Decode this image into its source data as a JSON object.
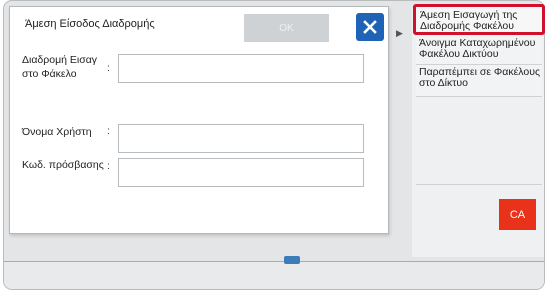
{
  "dialog": {
    "title": "Άμεση Είσοδος Διαδρομής",
    "ok_label": "OK",
    "fields": [
      {
        "label_line1": "Διαδρομή Εισαγ",
        "label_line2": "στο Φάκελο",
        "colon": ":",
        "value": ""
      },
      {
        "label": "Όνομα Χρήστη",
        "colon": ":",
        "value": ""
      },
      {
        "label": "Κωδ. πρόσβασης",
        "colon": ":",
        "value": ""
      }
    ]
  },
  "menu": {
    "items": [
      {
        "line1": "Άμεση Εισαγωγή της",
        "line2": "Διαδρομής Φακέλου"
      },
      {
        "line1": "Άνοιγμα Καταχωρημένου",
        "line2": "Φακέλου Δικτύου"
      },
      {
        "line1": "Παραπέμπει σε Φακέλους",
        "line2": "στο Δίκτυο"
      }
    ],
    "ca_label": "CA"
  },
  "colors": {
    "accent_blue": "#1f63b6",
    "highlight_red": "#d0112b",
    "ca_red": "#e8321a"
  }
}
